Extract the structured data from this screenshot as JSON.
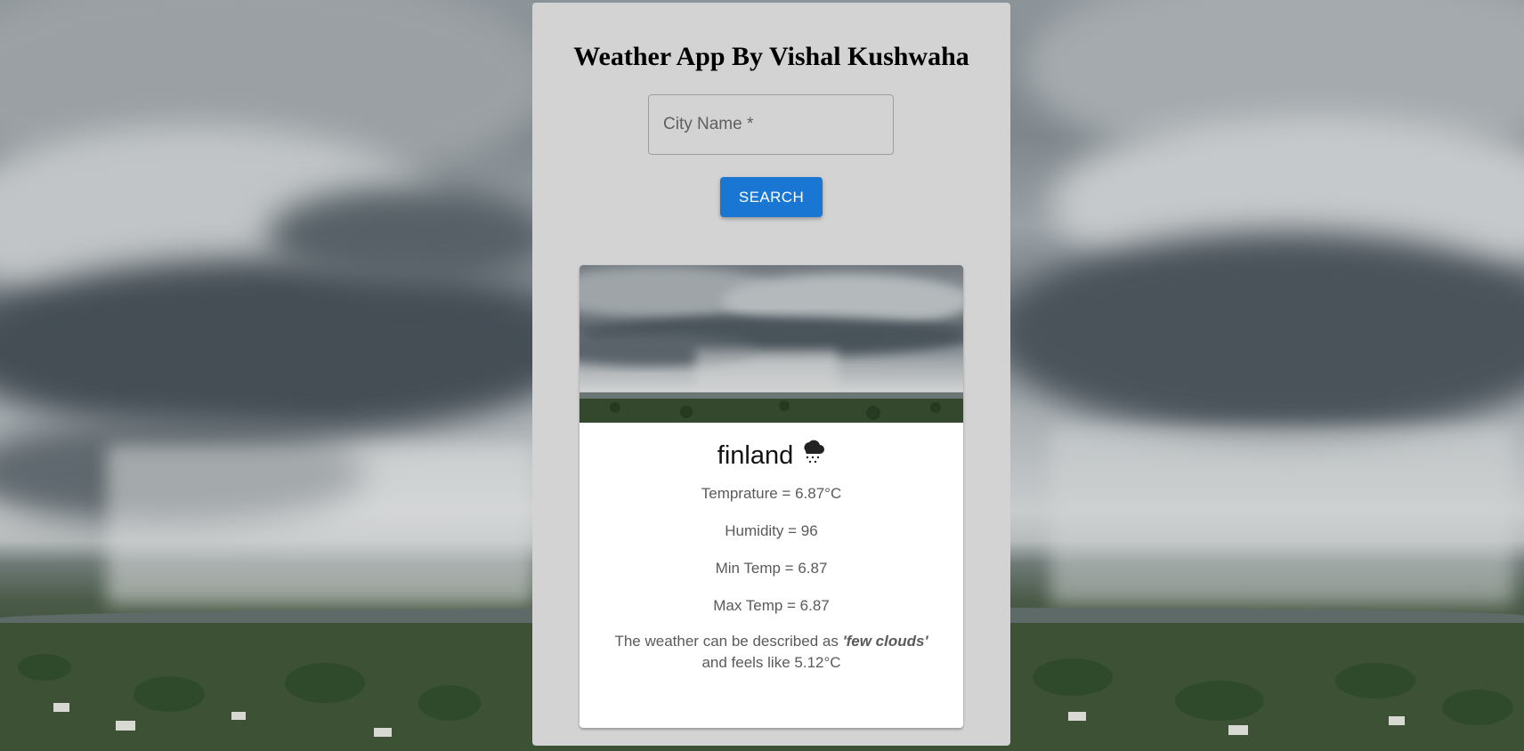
{
  "app": {
    "title": "Weather App By Vishal Kushwaha"
  },
  "search": {
    "placeholder": "City Name *",
    "value": "",
    "button_label": "SEARCH"
  },
  "weather_card": {
    "city": "finland",
    "weather_icon": "rain-cloud-icon",
    "temperature_text": "Temprature = 6.87°C",
    "humidity_text": "Humidity = 96",
    "min_temp_text": "Min Temp = 6.87",
    "max_temp_text": "Max Temp = 6.87",
    "description_prefix": "The weather can be described as ",
    "description_value": "'few clouds'",
    "feels_like_text": "and feels like 5.12°C"
  },
  "colors": {
    "panel": "#d3d3d3",
    "button": "#1976d2",
    "card": "#ffffff"
  }
}
